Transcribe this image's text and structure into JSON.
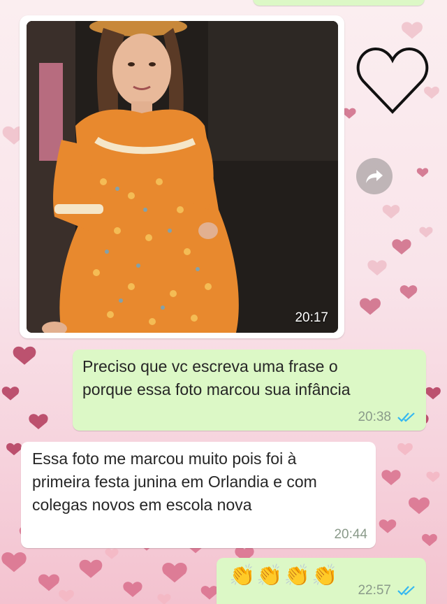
{
  "messages": {
    "photo": {
      "time": "20:17"
    },
    "out1": {
      "text": "Preciso que vc escreva uma frase o porque essa foto marcou sua infância",
      "time": "20:38"
    },
    "in1": {
      "text": "Essa foto  me marcou muito pois foi à  primeira festa junina  em Orlandia e com colegas  novos em escola nova",
      "time": "20:44"
    },
    "out2": {
      "emojis": "👏👏👏👏",
      "time": "22:57"
    }
  },
  "icons": {
    "forward": "forward-arrow-icon",
    "read_receipt": "double-check-icon",
    "heart": "heart-outline-icon"
  },
  "colors": {
    "outgoing_bubble": "#dcf8c6",
    "incoming_bubble": "#ffffff",
    "read_ticks": "#34b7f1"
  }
}
